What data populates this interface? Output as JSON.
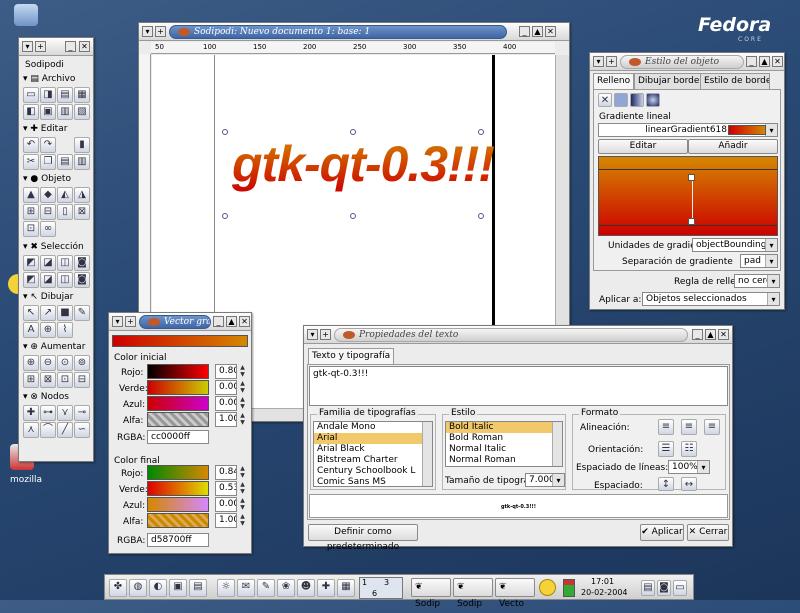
{
  "desktop": {
    "logo": "Fedora",
    "logo_sub": "CORE",
    "labels": [
      "mozilla"
    ]
  },
  "toolbox": {
    "title": "Sodipodi",
    "sections": [
      {
        "label": "Archivo"
      },
      {
        "label": "Editar"
      },
      {
        "label": "Objeto"
      },
      {
        "label": "Selección"
      },
      {
        "label": "Dibujar"
      },
      {
        "label": "Aumentar"
      },
      {
        "label": "Nodos"
      }
    ]
  },
  "canvas": {
    "title": "Sodipodi: Nuevo documento 1: base: 1",
    "ruler_labels": [
      "50",
      "100",
      "150",
      "200",
      "250",
      "300",
      "350",
      "400"
    ],
    "text": "gtk-qt-0.3!!!",
    "gradient_start": "#cc0000",
    "gradient_end": "#d58700"
  },
  "object_style": {
    "title": "Estilo del objeto",
    "tabs": [
      "Relleno",
      "Dibujar borde",
      "Estilo de borde"
    ],
    "section": "Gradiente lineal",
    "gradient_name": "linearGradient618",
    "edit_button": "Editar",
    "add_button": "Añadir",
    "units_label": "Unidades de gradiente",
    "units_value": "objectBoundingBox",
    "spread_label": "Separación de gradiente",
    "spread_value": "pad",
    "fill_rule_label": "Regla de relleno",
    "fill_rule_value": "no cero",
    "apply_label": "Aplicar a:",
    "apply_value": "Objetos seleccionados"
  },
  "vector_grad": {
    "title": "Vector gra",
    "start_section": "Color inicial",
    "end_section": "Color final",
    "channel_labels": [
      "Rojo:",
      "Verde:",
      "Azul:",
      "Alfa:"
    ],
    "start_values": [
      "0.80",
      "0.00",
      "0.00",
      "1.00"
    ],
    "end_values": [
      "0.84",
      "0.53",
      "0.00",
      "1.00"
    ],
    "rgba_label": "RGBA:",
    "start_rgba": "cc0000ff",
    "end_rgba": "d58700ff"
  },
  "text_props": {
    "title": "Propiedades del texto",
    "tab": "Texto y tipografía",
    "text_value": "gtk-qt-0.3!!!",
    "family_section": "Familia de tipografías",
    "families": [
      "Andale Mono",
      "Arial",
      "Arial Black",
      "Bitstream Charter",
      "Century Schoolbook L",
      "Comic Sans MS"
    ],
    "style_section": "Estilo",
    "styles": [
      "Bold Italic",
      "Bold Roman",
      "Normal Italic",
      "Normal Roman"
    ],
    "size_label": "Tamaño de tipografía:",
    "size_value": "7.000",
    "format_section": "Formato",
    "align_label": "Alineación:",
    "orient_label": "Orientación:",
    "spacing_label": "Espaciado de líneas:",
    "spacing_value": "100%",
    "spaced_label": "Espaciado:",
    "preview": "gtk-qt-0.3!!!",
    "default_button": "Definir como predeterminado",
    "apply_button": "Aplicar",
    "close_button": "Cerrar"
  },
  "taskbar": {
    "tasks": [
      "Sodip",
      "Sodip",
      "Vecto"
    ],
    "pager": [
      "1",
      "3",
      "6"
    ],
    "time": "17:01",
    "date": "20-02-2004"
  }
}
